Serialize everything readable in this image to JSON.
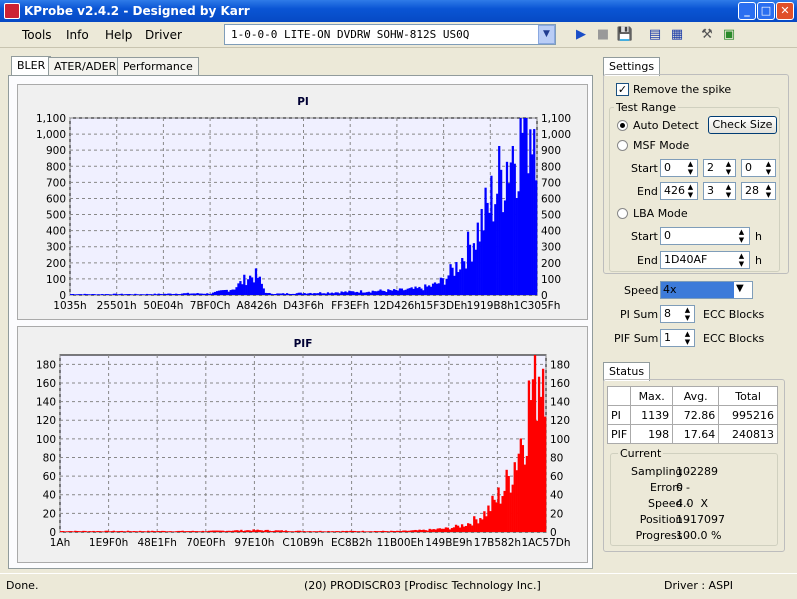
{
  "window": {
    "title": "KProbe v2.4.2 - Designed by Karr"
  },
  "menu": {
    "tools": "Tools",
    "info": "Info",
    "help": "Help",
    "driver": "Driver"
  },
  "drive": {
    "selected": "1-0-0-0 LITE-ON DVDRW SOHW-812S  US0Q"
  },
  "tabs": [
    {
      "label": "BLER"
    },
    {
      "label": "ATER/ADER"
    },
    {
      "label": "Performance"
    }
  ],
  "charts": {
    "pi": {
      "title": "PI",
      "yticks": [
        "1,100",
        "1,000",
        "900",
        "800",
        "700",
        "600",
        "500",
        "400",
        "300",
        "200",
        "100",
        "0"
      ],
      "xticks": [
        "1035h",
        "25501h",
        "50E04h",
        "7BF0Ch",
        "A8426h",
        "D43F6h",
        "FF3EFh",
        "12D426h",
        "15F3DEh",
        "1919B8h",
        "1C305Fh"
      ]
    },
    "pif": {
      "title": "PIF",
      "yticks": [
        "180",
        "160",
        "140",
        "120",
        "100",
        "80",
        "60",
        "40",
        "20",
        "0"
      ],
      "xticks": [
        "1Ah",
        "1E9F0h",
        "48E1Fh",
        "70E0Fh",
        "97E10h",
        "C10B9h",
        "EC8B2h",
        "11B00Eh",
        "149BE9h",
        "17B582h",
        "1AC57Dh"
      ]
    }
  },
  "chart_data": [
    {
      "type": "bar",
      "title": "PI",
      "ylim": [
        0,
        1100
      ],
      "color": "#0000ff",
      "x": [
        0,
        5,
        10,
        15,
        20,
        25,
        30,
        35,
        38,
        40,
        42,
        45,
        50,
        55,
        60,
        65,
        70,
        75,
        78,
        80,
        82,
        84,
        86,
        88,
        90,
        92,
        94,
        96,
        98,
        100
      ],
      "values": [
        6,
        5,
        6,
        5,
        7,
        10,
        9,
        40,
        110,
        120,
        10,
        8,
        12,
        15,
        20,
        25,
        28,
        40,
        60,
        90,
        150,
        220,
        320,
        430,
        560,
        700,
        860,
        980,
        1100,
        1139
      ],
      "x_positions_note": ""
    },
    {
      "type": "bar",
      "title": "PIF",
      "ylim": [
        0,
        190
      ],
      "color": "#ff0000",
      "x": [
        0,
        10,
        20,
        30,
        40,
        50,
        60,
        70,
        75,
        80,
        82,
        84,
        86,
        88,
        90,
        92,
        94,
        96,
        98,
        100
      ],
      "values": [
        1,
        1,
        1,
        1,
        2,
        1,
        1,
        1,
        2,
        4,
        6,
        9,
        14,
        22,
        35,
        50,
        80,
        120,
        170,
        198
      ]
    }
  ],
  "settings": {
    "title": "Settings",
    "remove_spike": "Remove the spike",
    "test_range": "Test Range",
    "auto_detect": "Auto Detect",
    "check_size": "Check Size",
    "msf_mode": "MSF Mode",
    "msf_start_label": "Start",
    "msf_start": [
      "0",
      "2",
      "0"
    ],
    "msf_end_label": "End",
    "msf_end": [
      "426",
      "3",
      "28"
    ],
    "lba_mode": "LBA Mode",
    "lba_start_label": "Start",
    "lba_start": "0",
    "lba_end_label": "End",
    "lba_end": "1D40AF",
    "h1": "h",
    "h2": "h",
    "speed_label": "Speed",
    "speed": "4x",
    "pi_sum_label": "PI Sum",
    "pi_sum": "8",
    "pi_sum_unit": "ECC Blocks",
    "pif_sum_label": "PIF Sum",
    "pif_sum": "1",
    "pif_sum_unit": "ECC Blocks"
  },
  "status": {
    "title": "Status",
    "headers": [
      "",
      "Max.",
      "Avg.",
      "Total"
    ],
    "rows": [
      {
        "name": "PI",
        "max": "1139",
        "avg": "72.86",
        "total": "995216"
      },
      {
        "name": "PIF",
        "max": "198",
        "avg": "17.64",
        "total": "240813"
      }
    ],
    "current_title": "Current",
    "sampling_label": "Sampling -",
    "sampling": "102289",
    "errors_label": "Errors -",
    "errors": "0",
    "speed_label": "Speed -",
    "speed": "4.0  X",
    "position_label": "Position -",
    "position": "1917097",
    "progress_label": "Progress -",
    "progress": "100.0 %"
  },
  "statusbar": {
    "left": "Done.",
    "middle": "(20) PRODISCR03 [Prodisc Technology Inc.]",
    "right": "Driver : ASPI"
  }
}
